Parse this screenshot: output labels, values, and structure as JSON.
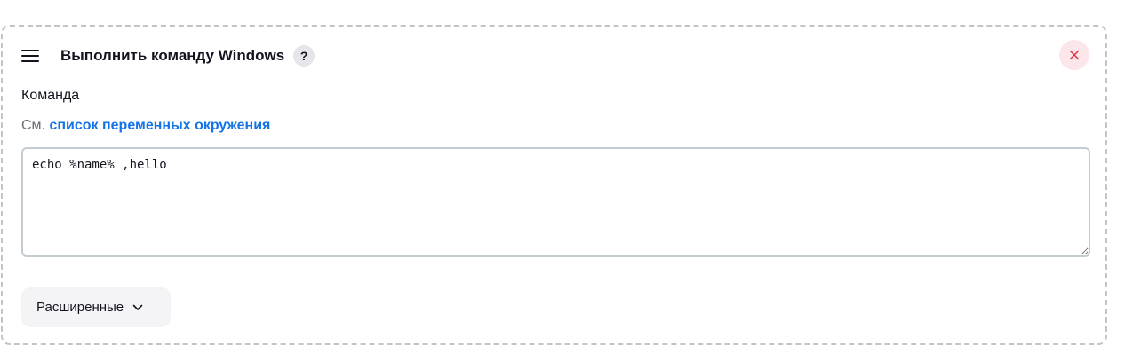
{
  "step": {
    "title": "Выполнить команду Windows",
    "help_label": "?",
    "icons": {
      "drag": "drag-handle-icon",
      "close": "close-icon",
      "advanced": "chevron-down-icon"
    },
    "colors": {
      "close_icon": "#e0283e",
      "close_bg": "#fbe6ea",
      "link": "#1473e6"
    }
  },
  "command_field": {
    "label": "Команда",
    "hint_prefix": "См.",
    "hint_link": "список переменных окружения",
    "value": "echo %name% ,hello"
  },
  "advanced_button": {
    "label": "Расширенные"
  }
}
